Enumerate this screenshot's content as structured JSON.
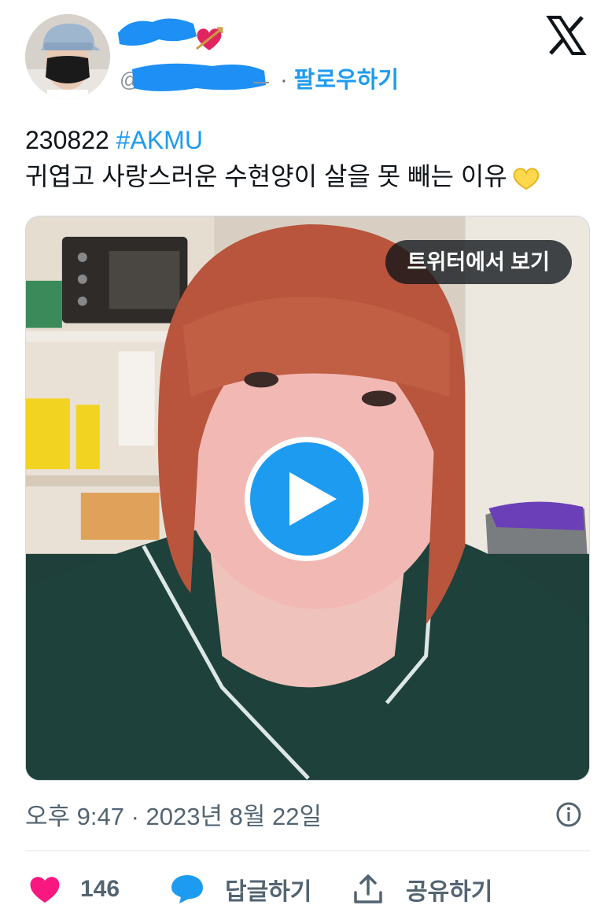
{
  "header": {
    "follow_separator": "·",
    "follow_label": "팔로우하기",
    "logo_icon": "x-logo-icon"
  },
  "tweet": {
    "line1_date": "230822",
    "line1_hashtag": "#AKMU",
    "line2_text": "귀엽고 사랑스러운 수현양이 살을 못 빼는 이유"
  },
  "media": {
    "view_button_label": "트위터에서 보기",
    "play_icon": "play-icon"
  },
  "meta": {
    "timestamp": "오후 9:47 · 2023년 8월 22일",
    "info_icon": "info-icon"
  },
  "actions": {
    "like_count": "146",
    "reply_label": "답글하기",
    "share_label": "공유하기"
  },
  "colors": {
    "accent": "#1d9bf0",
    "like": "#f91880",
    "muted": "#536471",
    "redaction": "#1e8ff5"
  }
}
